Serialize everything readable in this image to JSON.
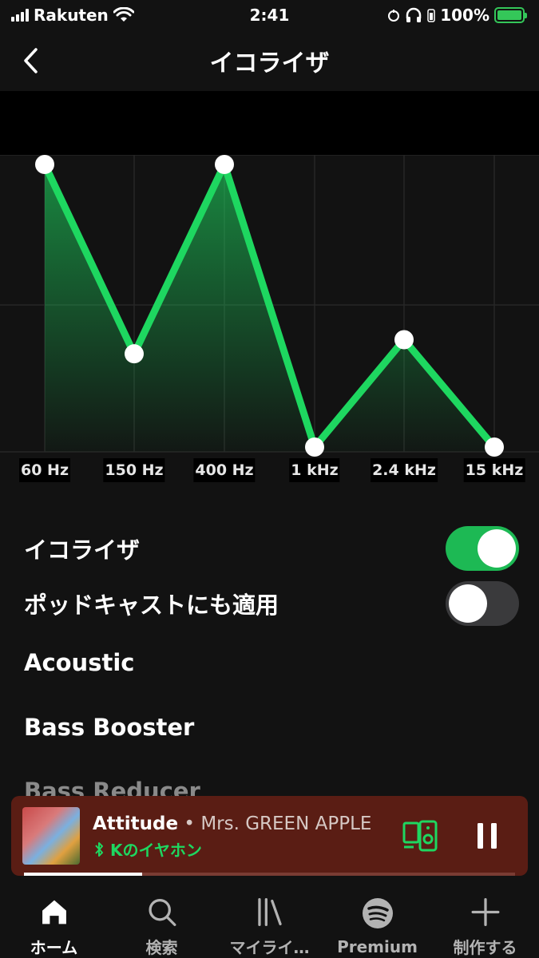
{
  "status": {
    "carrier": "Rakuten",
    "time": "2:41",
    "battery": "100%"
  },
  "header": {
    "title": "イコライザ"
  },
  "eq": {
    "bands": [
      "60 Hz",
      "150 Hz",
      "400 Hz",
      "1 kHz",
      "2.4 kHz",
      "15 kHz"
    ],
    "levels": [
      1.0,
      0.33,
      1.0,
      0.0,
      0.38,
      0.0
    ],
    "line_color": "#1ed760"
  },
  "settings": {
    "equalizer_label": "イコライザ",
    "equalizer_on": true,
    "podcast_label": "ポッドキャストにも適用",
    "podcast_on": false
  },
  "presets": [
    "Acoustic",
    "Bass Booster",
    "Bass Reducer"
  ],
  "player": {
    "title": "Attitude",
    "separator": " • ",
    "artist": "Mrs. GREEN APPLE",
    "device": "Kのイヤホン",
    "progress": 0.24
  },
  "tabs": [
    {
      "label": "ホーム",
      "icon": "home-icon",
      "active": true
    },
    {
      "label": "検索",
      "icon": "search-icon",
      "active": false
    },
    {
      "label": "マイライ…",
      "icon": "library-icon",
      "active": false
    },
    {
      "label": "Premium",
      "icon": "spotify-icon",
      "active": false
    },
    {
      "label": "制作する",
      "icon": "plus-icon",
      "active": false
    }
  ]
}
